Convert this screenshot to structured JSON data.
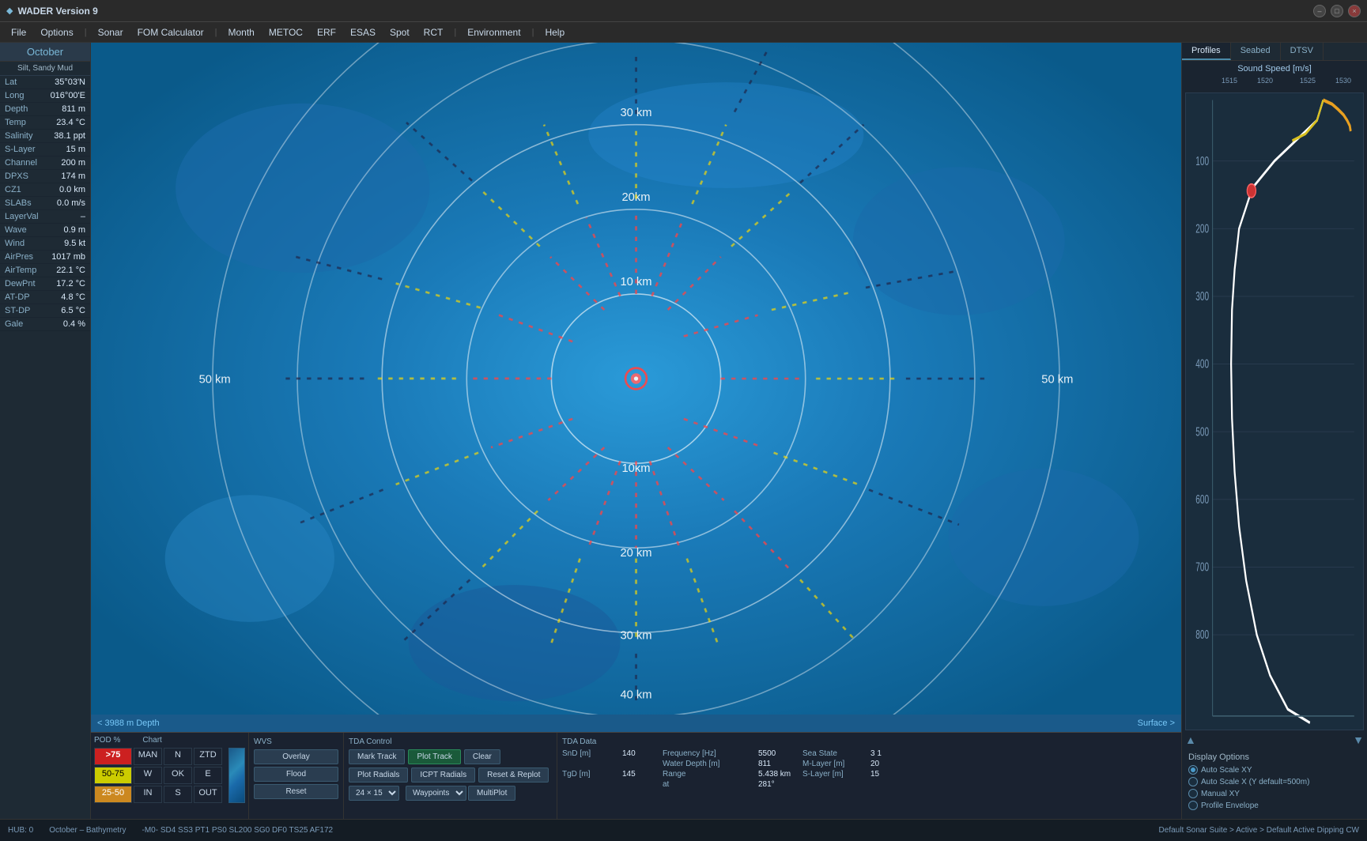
{
  "titlebar": {
    "title": "WADER Version 9",
    "logo": "W"
  },
  "menubar": {
    "items": [
      "File",
      "Options",
      "|",
      "Sonar",
      "FOM Calculator",
      "|",
      "Month",
      "METOC",
      "ERF",
      "ESAS",
      "Spot",
      "RCT",
      "|",
      "Environment",
      "|",
      "Help"
    ]
  },
  "left_panel": {
    "month": "October",
    "sediment": "Silt, Sandy Mud",
    "info": [
      {
        "label": "Lat",
        "value": "35°03'N"
      },
      {
        "label": "Long",
        "value": "016°00'E"
      },
      {
        "label": "Depth",
        "value": "811 m"
      },
      {
        "label": "Temp",
        "value": "23.4 °C"
      },
      {
        "label": "Salinity",
        "value": "38.1 ppt"
      },
      {
        "label": "S-Layer",
        "value": "15 m"
      },
      {
        "label": "Channel",
        "value": "200 m"
      },
      {
        "label": "DPXS",
        "value": "174 m"
      },
      {
        "label": "CZ1",
        "value": "0.0 km"
      },
      {
        "label": "SLABs",
        "value": "0.0 m/s"
      },
      {
        "label": "LayerVal",
        "value": "–"
      },
      {
        "label": "Wave",
        "value": "0.9 m"
      },
      {
        "label": "Wind",
        "value": "9.5 kt"
      },
      {
        "label": "AirPres",
        "value": "1017 mb"
      },
      {
        "label": "AirTemp",
        "value": "22.1 °C"
      },
      {
        "label": "DewPnt",
        "value": "17.2 °C"
      },
      {
        "label": "AT-DP",
        "value": "4.8 °C"
      },
      {
        "label": "ST-DP",
        "value": "6.5 °C"
      },
      {
        "label": "Gale",
        "value": "0.4 %"
      }
    ]
  },
  "depth_bar": {
    "left": "< 3988 m Depth",
    "right": "Surface >"
  },
  "right_panel": {
    "tabs": [
      "Profiles",
      "Seabed",
      "DTSV"
    ],
    "active_tab": "Profiles",
    "chart_title": "Sound Speed [m/s]",
    "axis_values": [
      "1515",
      "1520",
      "1525",
      "1530"
    ],
    "depth_labels": [
      "100",
      "200",
      "300",
      "400",
      "500",
      "600",
      "700",
      "800"
    ],
    "display_options": {
      "title": "Display Options",
      "options": [
        {
          "label": "Auto Scale XY",
          "selected": true
        },
        {
          "label": "Auto Scale X (Y default=500m)",
          "selected": false
        },
        {
          "label": "Manual XY",
          "selected": false
        },
        {
          "label": "Profile Envelope",
          "selected": false
        }
      ]
    }
  },
  "bottom": {
    "pod_section": {
      "label": "POD %",
      "chart_label": "Chart",
      "rows": [
        {
          "pod": ">75",
          "col1": "MAN",
          "col2": "N",
          "col3": "ZTD",
          "pod_class": "red-bg"
        },
        {
          "pod": "50-75",
          "col1": "W",
          "col2": "OK",
          "col3": "E",
          "pod_class": "yellow-bg"
        },
        {
          "pod": "25-50",
          "col1": "IN",
          "col2": "S",
          "col3": "OUT",
          "pod_class": "orange-bg"
        }
      ]
    },
    "wvs_section": {
      "label": "WVS",
      "buttons": [
        "Overlay",
        "Flood",
        "Reset"
      ]
    },
    "tda_control": {
      "label": "TDA Control",
      "buttons_row1": [
        "Mark Track",
        "Plot Track",
        "Clear"
      ],
      "buttons_row2": [
        "Plot Radials",
        "ICPT Radials",
        "Reset & Replot"
      ],
      "dropdown": "24 × 15",
      "combo_items": [
        "Waypoints",
        "MultiPlot"
      ]
    },
    "tda_data": {
      "label": "TDA Data",
      "fields": [
        {
          "label": "SnD [m]",
          "value": "140",
          "label2": "Frequency [Hz]",
          "value2": "5500"
        },
        {
          "label": "",
          "value": "",
          "label2": "Water Depth [m]",
          "value2": "811"
        },
        {
          "label": "TgD [m]",
          "value": "145",
          "label2": "Range",
          "value2": "5.438 km"
        },
        {
          "label": "",
          "value": "",
          "label2": "",
          "value2": ""
        }
      ],
      "sea_state_label": "Sea State",
      "sea_state_value": "3",
      "sea_state_extra": "1",
      "m_layer_label": "M-Layer [m]",
      "m_layer_value": "20",
      "at_label": "at",
      "at_value": "281°",
      "s_layer_label": "S-Layer [m]",
      "s_layer_value": "15"
    }
  },
  "statusbar": {
    "hub": "HUB: 0",
    "location": "October – Bathymetry",
    "codes": "-M0-  SD4  SS3  PT1  PS0  SL200  SG0  DF0  TS25  AF172",
    "suite": "Default Sonar Suite > Active > Default Active Dipping CW"
  },
  "map": {
    "rings": [
      "10 km",
      "10 km",
      "20 km",
      "20 km",
      "30 km",
      "30 km",
      "40 km",
      "40 km",
      "50 km",
      "50 km"
    ],
    "ring_labels": [
      "10 km",
      "20 km",
      "30 km",
      "40 km",
      "50 km"
    ]
  }
}
